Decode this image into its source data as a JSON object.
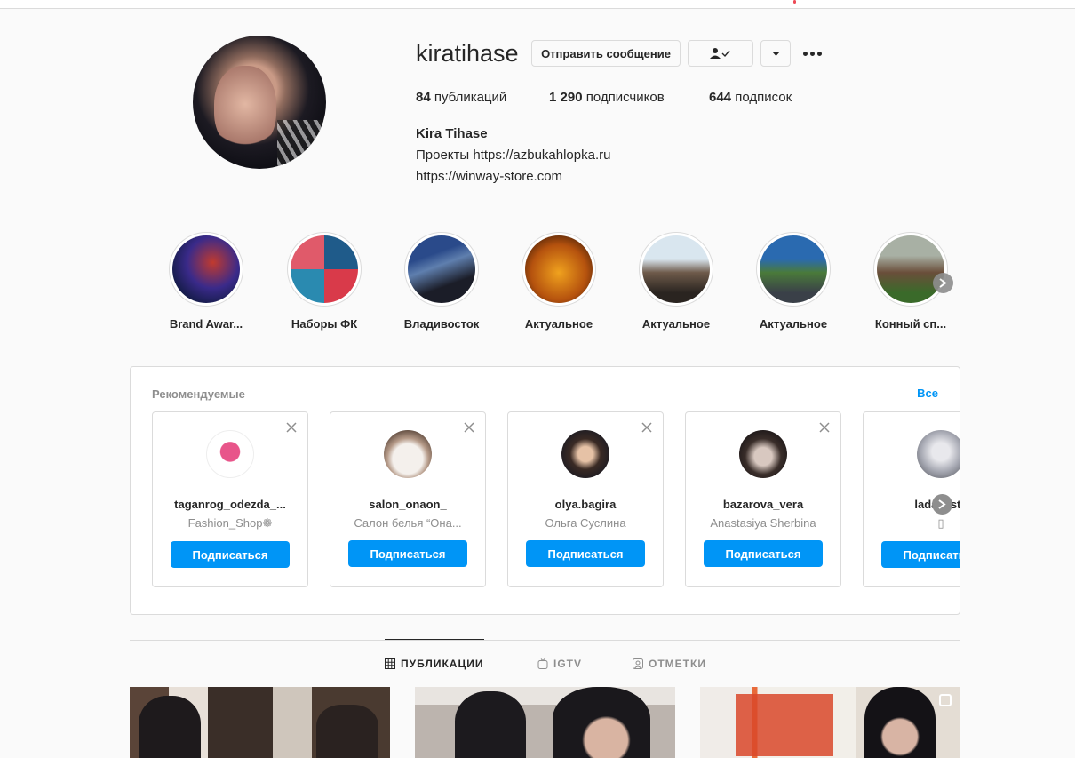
{
  "profile": {
    "username": "kiratihase",
    "message_button": "Отправить сообщение",
    "stats": [
      {
        "count": "84",
        "label": " публикаций"
      },
      {
        "count": "1 290",
        "label": " подписчиков"
      },
      {
        "count": "644",
        "label": " подписок"
      }
    ],
    "full_name": "Kira Tihase",
    "bio_line1": "Проекты https://azbukahlopka.ru",
    "bio_line2": "https://winway-store.com"
  },
  "highlights": [
    {
      "label": "Brand Awar...",
      "icon": "highlight-cover"
    },
    {
      "label": "Наборы ФК",
      "icon": "highlight-cover"
    },
    {
      "label": "Владивосток",
      "icon": "highlight-cover"
    },
    {
      "label": "Актуальное",
      "icon": "highlight-cover"
    },
    {
      "label": "Актуальное",
      "icon": "highlight-cover"
    },
    {
      "label": "Актуальное",
      "icon": "highlight-cover"
    },
    {
      "label": "Конный сп...",
      "icon": "highlight-cover"
    }
  ],
  "suggested": {
    "title": "Рекомендуемые",
    "see_all": "Все",
    "follow_label": "Подписаться",
    "cards": [
      {
        "username": "taganrog_odezda_...",
        "name": "Fashion_Shop❁"
      },
      {
        "username": "salon_onaon_",
        "name": "Салон белья “Она..."
      },
      {
        "username": "olya.bagira",
        "name": "Ольга Суслина"
      },
      {
        "username": "bazarova_vera",
        "name": "Anastasiya Sherbina"
      },
      {
        "username": "ladavesta",
        "name": "▯"
      }
    ]
  },
  "tabs": [
    {
      "label": "ПУБЛИКАЦИИ",
      "icon": "grid-icon",
      "active": true
    },
    {
      "label": "IGTV",
      "icon": "igtv-icon",
      "active": false
    },
    {
      "label": "ОТМЕТКИ",
      "icon": "tagged-icon",
      "active": false
    }
  ],
  "colors": {
    "accent": "#0095f6",
    "text": "#262626",
    "muted": "#8e8e8e",
    "border": "#dbdbdb"
  }
}
